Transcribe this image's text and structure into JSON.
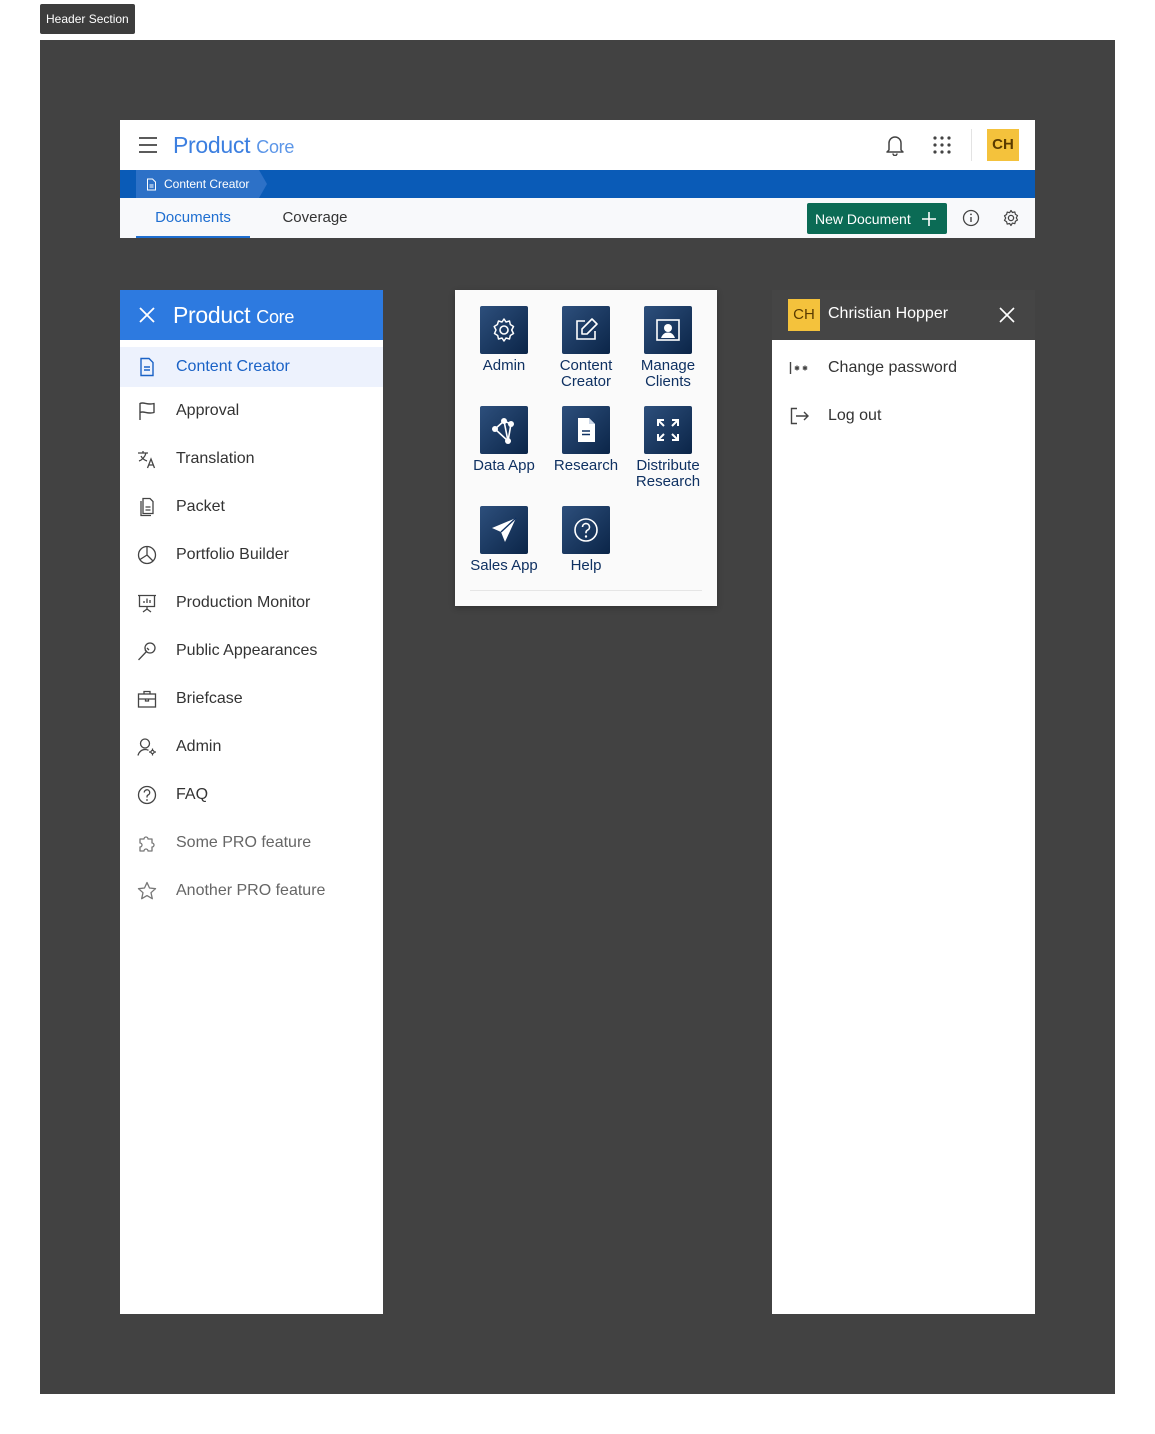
{
  "section_tag": "Header Section",
  "brand": {
    "product": "Product",
    "core": "Core"
  },
  "user": {
    "initials": "CH",
    "name": "Christian Hopper"
  },
  "breadcrumb": {
    "label": "Content Creator"
  },
  "tabs": [
    {
      "label": "Documents",
      "active": true
    },
    {
      "label": "Coverage",
      "active": false
    }
  ],
  "actions": {
    "new_document": "New Document"
  },
  "sidenav": {
    "items": [
      {
        "label": "Content Creator",
        "icon": "document-icon",
        "active": true
      },
      {
        "label": "Approval",
        "icon": "flag-icon"
      },
      {
        "label": "Translation",
        "icon": "translate-icon"
      },
      {
        "label": "Packet",
        "icon": "packet-icon"
      },
      {
        "label": "Portfolio Builder",
        "icon": "pie-chart-icon"
      },
      {
        "label": "Production Monitor",
        "icon": "presentation-chart-icon"
      },
      {
        "label": "Public Appearances",
        "icon": "microphone-icon"
      },
      {
        "label": "Briefcase",
        "icon": "briefcase-icon"
      },
      {
        "label": "Admin",
        "icon": "user-gear-icon"
      },
      {
        "label": "FAQ",
        "icon": "question-icon"
      },
      {
        "label": "Some PRO feature",
        "icon": "puzzle-icon"
      },
      {
        "label": "Another PRO feature",
        "icon": "star-icon"
      }
    ]
  },
  "apps": [
    {
      "label1": "Admin",
      "label2": "",
      "icon": "gear-icon"
    },
    {
      "label1": "Content",
      "label2": "Creator",
      "icon": "edit-icon"
    },
    {
      "label1": "Manage",
      "label2": "Clients",
      "icon": "user-portrait-icon"
    },
    {
      "label1": "Data App",
      "label2": "",
      "icon": "network-icon"
    },
    {
      "label1": "Research",
      "label2": "",
      "icon": "document-icon"
    },
    {
      "label1": "Distribute",
      "label2": "Research",
      "icon": "expand-icon"
    },
    {
      "label1": "Sales App",
      "label2": "",
      "icon": "paper-plane-icon"
    },
    {
      "label1": "Help",
      "label2": "",
      "icon": "question-icon"
    }
  ],
  "user_menu": [
    {
      "label": "Change password",
      "icon": "password-icon"
    },
    {
      "label": "Log out",
      "icon": "logout-icon"
    }
  ],
  "colors": {
    "stage": "#424242",
    "brand_blue": "#2d7ae0",
    "nav_bar": "#0a5bb7",
    "primary_button": "#0b6b55",
    "avatar": "#f4c23c",
    "app_tile": "#0b2548"
  }
}
